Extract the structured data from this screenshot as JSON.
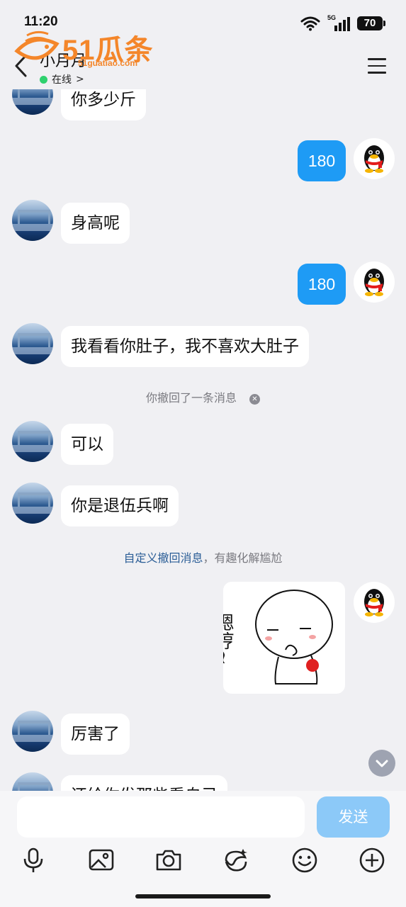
{
  "status_bar": {
    "time": "11:20",
    "network": "5G",
    "battery": "70"
  },
  "header": {
    "contact_name": "小月月",
    "status": "在线",
    "status_chevron": ">"
  },
  "watermark": {
    "brand": "51瓜条",
    "url": "51guatiao.com"
  },
  "messages": [
    {
      "side": "left",
      "text": "你多少斤"
    },
    {
      "side": "right",
      "text": "180"
    },
    {
      "side": "left",
      "text": "身高呢"
    },
    {
      "side": "right",
      "text": "180"
    },
    {
      "side": "left",
      "text": "我看看你肚子，我不喜欢大肚子"
    },
    {
      "side": "system",
      "text": "你撤回了一条消息"
    },
    {
      "side": "left",
      "text": "可以"
    },
    {
      "side": "left",
      "text": "你是退伍兵啊"
    },
    {
      "side": "system",
      "link": "自定义撤回消息",
      "text": "，有趣化解尴尬"
    },
    {
      "side": "right",
      "type": "sticker",
      "caption": "嗯哼~"
    },
    {
      "side": "left",
      "text": "厉害了"
    },
    {
      "side": "left",
      "text": "还给你发那些看自己"
    }
  ],
  "input": {
    "placeholder": "",
    "send_label": "发送"
  },
  "toolbar": [
    "mic-icon",
    "image-icon",
    "camera-icon",
    "sticker-icon",
    "emoji-icon",
    "plus-icon"
  ],
  "colors": {
    "bubble_sent": "#1e9bf5",
    "send_button": "#8cc9f8",
    "online_dot": "#2fd16e",
    "link": "#2a5d96"
  }
}
